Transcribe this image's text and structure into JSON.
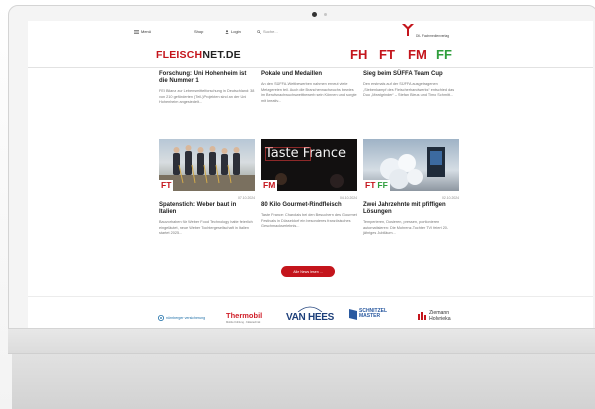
{
  "nav": {
    "menu": "Menü",
    "shop": "Shop",
    "login": "Login",
    "search": "Suche..."
  },
  "publisher": {
    "name": "DIL Fachmedienverlag"
  },
  "brand": {
    "part1": "FLEISCH",
    "part2": "NET.DE"
  },
  "magazine_tags": [
    {
      "label": "FH",
      "color": "#c4151c"
    },
    {
      "label": "FT",
      "color": "#c4151c"
    },
    {
      "label": "FM",
      "color": "#c4151c"
    },
    {
      "label": "FF",
      "color": "#2e9e3c"
    }
  ],
  "articles_top": [
    {
      "title": "Forschung: Uni Hohenheim ist die Nummer 1",
      "excerpt": "FEI Bilanz zur Lebensmittelforschung in Deutschland: 38 von 210 geförderten (Teil-)Projekten sind an der Uni Hohenheim angesiedelt..."
    },
    {
      "title": "Pokale und Medaillen",
      "excerpt": "An den SÜFFA-Wettbewerben nahmen erneut viele Metzgereien teil. Auch die Branchennachwuchs bewies im Berufsnachwuchswettbewerb sein Können und sorgte mit kreativ..."
    },
    {
      "title": "Sieg beim SÜFFA Team Cup",
      "excerpt": "Den erstmals auf der SÜFFA ausgetragenen „Siebenkampf des Fleischerhandwerks“ entschied das Duo „Meatgrinder“ – Stefan Bleus und Timo Schmitt..."
    }
  ],
  "articles_bottom": [
    {
      "title": "Spatenstich: Weber baut in Italien",
      "excerpt": "Bauvorhaben für Weber Food Technology hatte feierlich eingeläutet, neue Weber Tochtergesellschaft in Italien startet 2025...",
      "date": "07.10.2024",
      "badges": [
        {
          "label": "FT",
          "color": "#c4151c"
        }
      ]
    },
    {
      "title": "80 Kilo Gourmet-Rindfleisch",
      "excerpt": "Taste France: Charolais bei den Besuchern des Gourmet Festivals in Düsseldorf ein besonderes französisches Geschmackserlebnis...",
      "date": "04.10.2024",
      "badges": [
        {
          "label": "FM",
          "color": "#c4151c"
        }
      ],
      "image_text": "Taste France"
    },
    {
      "title": "Zwei Jahrzehnte mit pfiffigen Lösungen",
      "excerpt": "Temperieren, Dosieren, pressen, portionieren automatisieren: Die Mohrenz-Tochter TVI feiert 20-jähriges Jubiläum...",
      "date": "02.10.2024",
      "badges": [
        {
          "label": "FT",
          "color": "#c4151c"
        },
        {
          "label": "FF",
          "color": "#2e9e3c"
        }
      ]
    }
  ],
  "more_button": "Alle News lesen ...",
  "partners": [
    {
      "name": "nürnberger versicherung",
      "sub": ""
    },
    {
      "name": "Thermobil",
      "sub": "Mobile Kühlung · Kältetechnik"
    },
    {
      "name": "VAN HEES",
      "sub": ""
    },
    {
      "name": "SCHNITZEL MASTER",
      "sub": ""
    },
    {
      "name": "Ziemann",
      "sub": "Holvrieka"
    }
  ],
  "colors": {
    "brand_red": "#c4151c",
    "brand_green": "#2e9e3c"
  }
}
